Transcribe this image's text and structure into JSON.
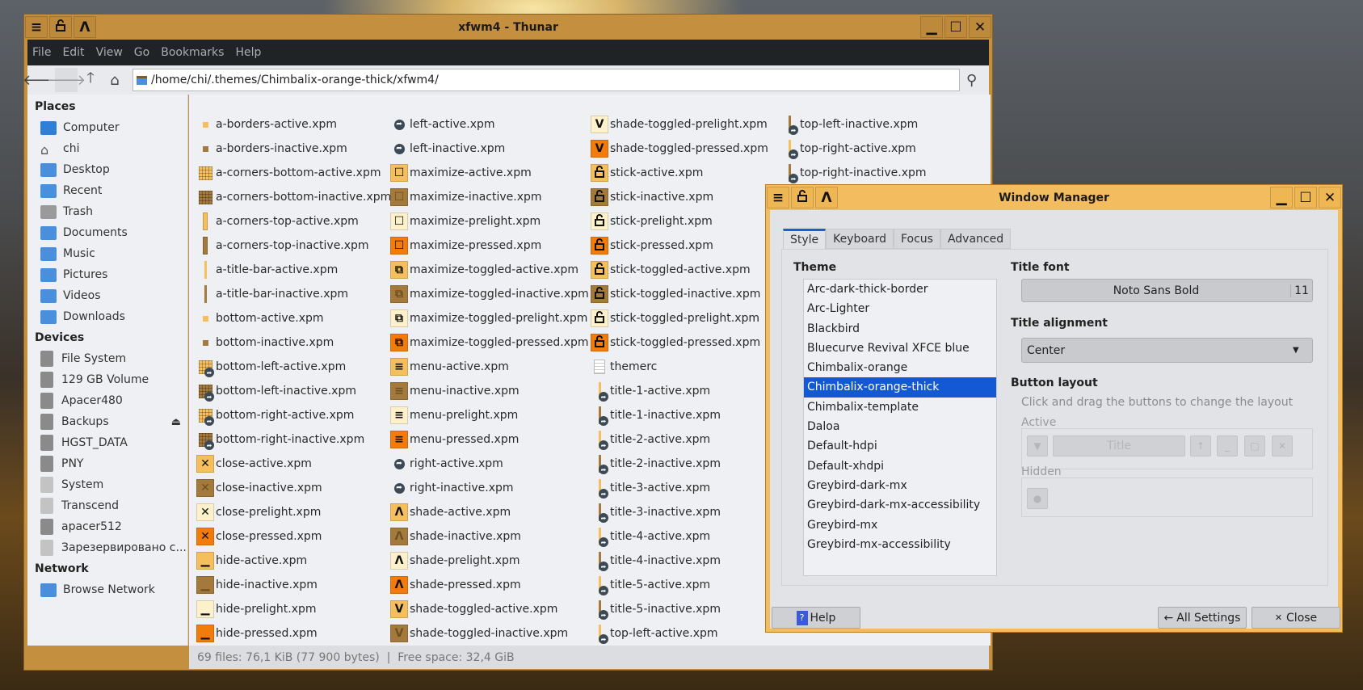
{
  "thunar": {
    "title": "xfwm4 - Thunar",
    "menu": [
      "File",
      "Edit",
      "View",
      "Go",
      "Bookmarks",
      "Help"
    ],
    "location": "/home/chi/.themes/Chimbalix-orange-thick/xfwm4/",
    "sidebar": {
      "places_heading": "Places",
      "places": [
        {
          "label": "Computer",
          "icon": "computer"
        },
        {
          "label": "chi",
          "icon": "home"
        },
        {
          "label": "Desktop",
          "icon": "desktop"
        },
        {
          "label": "Recent",
          "icon": "recent"
        },
        {
          "label": "Trash",
          "icon": "trash"
        },
        {
          "label": "Documents",
          "icon": "folder"
        },
        {
          "label": "Music",
          "icon": "folder"
        },
        {
          "label": "Pictures",
          "icon": "folder"
        },
        {
          "label": "Videos",
          "icon": "folder"
        },
        {
          "label": "Downloads",
          "icon": "folder"
        }
      ],
      "devices_heading": "Devices",
      "devices": [
        {
          "label": "File System",
          "icon": "drive"
        },
        {
          "label": "129 GB Volume",
          "icon": "drive"
        },
        {
          "label": "Apacer480",
          "icon": "drive"
        },
        {
          "label": "Backups",
          "icon": "drive",
          "eject": true
        },
        {
          "label": "HGST_DATA",
          "icon": "drive"
        },
        {
          "label": "PNY",
          "icon": "drive"
        },
        {
          "label": "System",
          "icon": "drive-light"
        },
        {
          "label": "Transcend",
          "icon": "drive-light"
        },
        {
          "label": "apacer512",
          "icon": "drive"
        },
        {
          "label": "Зарезервировано с...",
          "icon": "drive-light"
        }
      ],
      "network_heading": "Network",
      "network": [
        {
          "label": "Browse Network",
          "icon": "network"
        }
      ]
    },
    "files": [
      [
        "a-borders-active.xpm|dot|a",
        "a-borders-inactive.xpm|dot|i",
        "a-corners-bottom-active.xpm|grid|a",
        "a-corners-bottom-inactive.xpm|grid|i",
        "a-corners-top-active.xpm|tall|a",
        "a-corners-top-inactive.xpm|tall|i",
        "a-title-bar-active.xpm|line|a",
        "a-title-bar-inactive.xpm|line|i",
        "bottom-active.xpm|dot|a",
        "bottom-inactive.xpm|dot|i",
        "bottom-left-active.xpm|gridlink|a",
        "bottom-left-inactive.xpm|gridlink|i",
        "bottom-right-active.xpm|gridlink|a",
        "bottom-right-inactive.xpm|gridlink|i",
        "close-active.xpm|close|a",
        "close-inactive.xpm|close|i",
        "close-prelight.xpm|close|p",
        "close-pressed.xpm|close|x",
        "hide-active.xpm|hide|a",
        "hide-inactive.xpm|hide|i",
        "hide-prelight.xpm|hide|p",
        "hide-pressed.xpm|hide|x"
      ],
      [
        "left-active.xpm|link|a",
        "left-inactive.xpm|link|i",
        "maximize-active.xpm|max|a",
        "maximize-inactive.xpm|max|i",
        "maximize-prelight.xpm|max|p",
        "maximize-pressed.xpm|max|x",
        "maximize-toggled-active.xpm|maxt|a",
        "maximize-toggled-inactive.xpm|maxt|i",
        "maximize-toggled-prelight.xpm|maxt|p",
        "maximize-toggled-pressed.xpm|maxt|x",
        "menu-active.xpm|menu|a",
        "menu-inactive.xpm|menu|i",
        "menu-prelight.xpm|menu|p",
        "menu-pressed.xpm|menu|x",
        "right-active.xpm|link|a",
        "right-inactive.xpm|link|i",
        "shade-active.xpm|shade|a",
        "shade-inactive.xpm|shade|i",
        "shade-prelight.xpm|shade|p",
        "shade-pressed.xpm|shade|x",
        "shade-toggled-active.xpm|shadet|a",
        "shade-toggled-inactive.xpm|shadet|i"
      ],
      [
        "shade-toggled-prelight.xpm|shadet|p",
        "shade-toggled-pressed.xpm|shadet|x",
        "stick-active.xpm|stick|a",
        "stick-inactive.xpm|stick|i",
        "stick-prelight.xpm|stick|p",
        "stick-pressed.xpm|stick|x",
        "stick-toggled-active.xpm|stick|a",
        "stick-toggled-inactive.xpm|stick|i",
        "stick-toggled-prelight.xpm|stick|p",
        "stick-toggled-pressed.xpm|stick|x",
        "themerc|doc|n",
        "title-1-active.xpm|taillink|a",
        "title-1-inactive.xpm|taillink|i",
        "title-2-active.xpm|taillink|a",
        "title-2-inactive.xpm|taillink|i",
        "title-3-active.xpm|taillink|a",
        "title-3-inactive.xpm|taillink|i",
        "title-4-active.xpm|taillink|a",
        "title-4-inactive.xpm|taillink|i",
        "title-5-active.xpm|taillink|a",
        "title-5-inactive.xpm|taillink|i",
        "top-left-active.xpm|taillink|a"
      ],
      [
        "top-left-inactive.xpm|taillink|i",
        "top-right-active.xpm|taillink|a",
        "top-right-inactive.xpm|taillink|i"
      ]
    ],
    "status": "69 files: 76,1 KiB (77 900 bytes)  |  Free space: 32,4 GiB"
  },
  "wm": {
    "title": "Window Manager",
    "tabs": [
      "Style",
      "Keyboard",
      "Focus",
      "Advanced"
    ],
    "theme_label": "Theme",
    "themes": [
      "Arc-dark-thick-border",
      "Arc-Lighter",
      "Blackbird",
      "Bluecurve Revival XFCE blue",
      "Chimbalix-orange",
      "Chimbalix-orange-thick",
      "Chimbalix-template",
      "Daloa",
      "Default-hdpi",
      "Default-xhdpi",
      "Greybird-dark-mx",
      "Greybird-dark-mx-accessibility",
      "Greybird-mx",
      "Greybird-mx-accessibility"
    ],
    "selected_theme": "Chimbalix-orange-thick",
    "title_font_label": "Title font",
    "title_font": "Noto Sans Bold",
    "title_font_size": "11",
    "title_alignment_label": "Title alignment",
    "title_alignment": "Center",
    "button_layout_label": "Button layout",
    "button_layout_hint": "Click and drag the buttons to change the layout",
    "active_label": "Active",
    "hidden_label": "Hidden",
    "title_button": "Title",
    "help": "Help",
    "all_settings": "All Settings",
    "close": "Close"
  },
  "colors": {
    "active": "#f5bf5e",
    "inactive": "#a37a3c",
    "prelight": "#fdf1cc",
    "pressed": "#f27b0c",
    "selection": "#1259d3",
    "wm_title": "#f3bd5f",
    "thunar_title": "#c4903f"
  }
}
